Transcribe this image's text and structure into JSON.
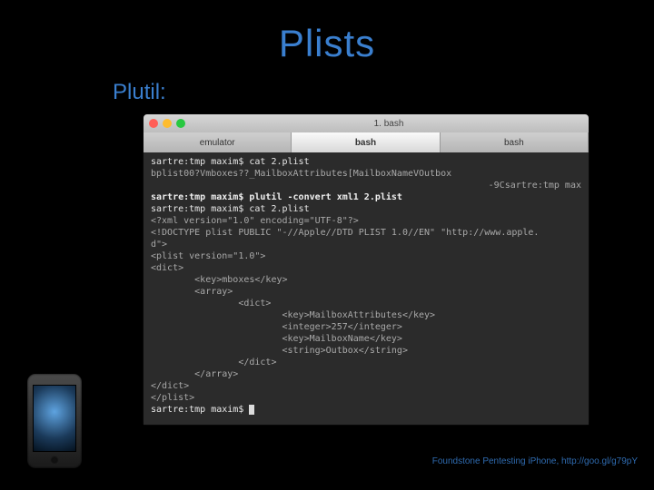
{
  "title": "Plists",
  "subtitle": "Plutil:",
  "window": {
    "title": "1. bash",
    "tabs": [
      "emulator",
      "bash",
      "bash"
    ],
    "active_tab_index": 1
  },
  "terminal": {
    "lines": [
      {
        "style": "bright",
        "t": "sartre:tmp maxim$ cat 2.plist"
      },
      {
        "style": "",
        "t": "bplist00?Vmboxes??_MailboxAttributes[MailboxNameVOutbox"
      },
      {
        "style": "right",
        "t": "-9Csartre:tmp max"
      },
      {
        "style": "bold",
        "t": "sartre:tmp maxim$ plutil -convert xml1 2.plist"
      },
      {
        "style": "bright",
        "t": "sartre:tmp maxim$ cat 2.plist"
      },
      {
        "style": "",
        "t": "<?xml version=\"1.0\" encoding=\"UTF-8\"?>"
      },
      {
        "style": "",
        "t": "<!DOCTYPE plist PUBLIC \"-//Apple//DTD PLIST 1.0//EN\" \"http://www.apple."
      },
      {
        "style": "",
        "t": "d\">"
      },
      {
        "style": "",
        "t": "<plist version=\"1.0\">"
      },
      {
        "style": "",
        "t": "<dict>"
      },
      {
        "style": "",
        "t": "        <key>mboxes</key>"
      },
      {
        "style": "",
        "t": "        <array>"
      },
      {
        "style": "",
        "t": "                <dict>"
      },
      {
        "style": "",
        "t": "                        <key>MailboxAttributes</key>"
      },
      {
        "style": "",
        "t": "                        <integer>257</integer>"
      },
      {
        "style": "",
        "t": "                        <key>MailboxName</key>"
      },
      {
        "style": "",
        "t": "                        <string>Outbox</string>"
      },
      {
        "style": "",
        "t": "                </dict>"
      },
      {
        "style": "",
        "t": "        </array>"
      },
      {
        "style": "",
        "t": "</dict>"
      },
      {
        "style": "",
        "t": "</plist>"
      },
      {
        "style": "prompt",
        "t": "sartre:tmp maxim$ "
      }
    ]
  },
  "credit": "Foundstone Pentesting iPhone, http://goo.gl/g79pY"
}
